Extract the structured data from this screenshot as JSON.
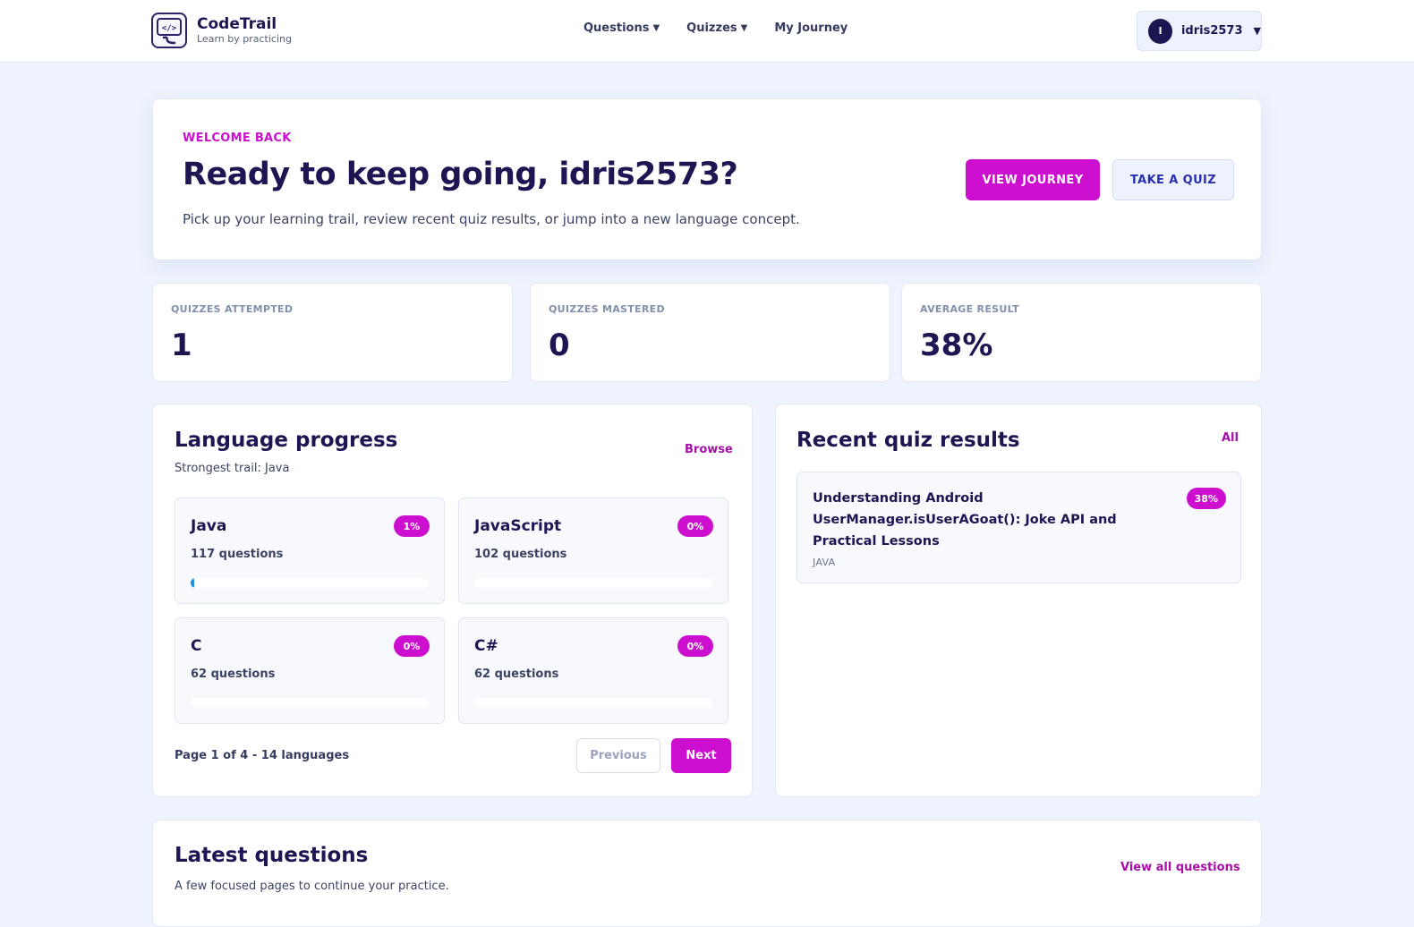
{
  "header": {
    "brand_name": "CodeTrail",
    "brand_tagline": "Learn by practicing",
    "nav": [
      {
        "label": "Questions",
        "caret": "▼"
      },
      {
        "label": "Quizzes",
        "caret": "▼"
      },
      {
        "label": "My Journey",
        "caret": ""
      }
    ],
    "user": {
      "initial": "I",
      "name": "idris2573",
      "caret": "▼"
    }
  },
  "welcome": {
    "eyebrow": "WELCOME BACK",
    "title": "Ready to keep going, idris2573?",
    "description": "Pick up your learning trail, review recent quiz results, or jump into a new language concept.",
    "primary_button": "VIEW JOURNEY",
    "secondary_button": "TAKE A QUIZ"
  },
  "stats": [
    {
      "label": "QUIZZES ATTEMPTED",
      "value": "1"
    },
    {
      "label": "QUIZZES MASTERED",
      "value": "0"
    },
    {
      "label": "AVERAGE RESULT",
      "value": "38%"
    }
  ],
  "language_progress": {
    "title": "Language progress",
    "subtitle": "Strongest trail: Java",
    "browse_link": "Browse",
    "languages": [
      {
        "name": "Java",
        "badge": "1%",
        "progress": 0.01,
        "count": "117 questions"
      },
      {
        "name": "JavaScript",
        "badge": "0%",
        "progress": 0,
        "count": "102 questions"
      },
      {
        "name": "C",
        "badge": "0%",
        "progress": 0,
        "count": "62 questions"
      },
      {
        "name": "C#",
        "badge": "0%",
        "progress": 0,
        "count": "62 questions"
      }
    ],
    "pager_text": "Page 1 of 4 - 14 languages",
    "previous_label": "Previous",
    "next_label": "Next"
  },
  "recent_results": {
    "title": "Recent quiz results",
    "all_link": "All",
    "items": [
      {
        "title": "Understanding Android UserManager.isUserAGoat(): Joke API and Practical Lessons",
        "language": "JAVA",
        "score": "38%"
      }
    ]
  },
  "latest_questions": {
    "title": "Latest questions",
    "subtitle": "A few focused pages to continue your practice.",
    "view_all_link": "View all questions"
  },
  "colors": {
    "accent": "#cc0fce",
    "navy": "#1d1653",
    "background": "#eef3fd",
    "progress": "#1e8ee0"
  }
}
